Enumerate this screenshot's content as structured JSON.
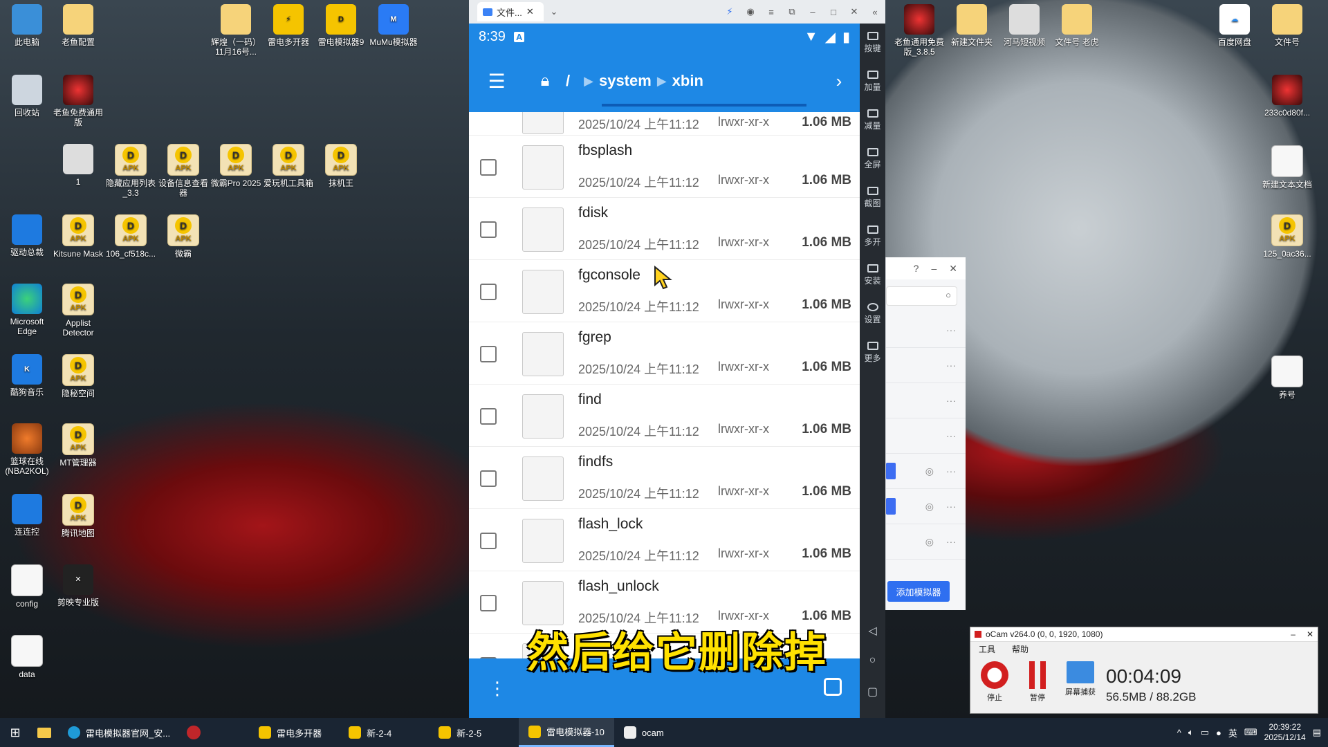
{
  "desktop_icons": [
    {
      "label": "此电脑",
      "icon": "computer-icon"
    },
    {
      "label": "老鱼配置",
      "icon": "folder-icon"
    },
    {
      "label": "回收站",
      "icon": "recycle-bin-icon"
    },
    {
      "label": "老鱼免费通用版",
      "icon": "app-icon"
    },
    {
      "label": "1",
      "icon": "photo-icon"
    },
    {
      "label": "隐藏应用列表_3.3",
      "icon": "apk-icon"
    },
    {
      "label": "设备信息查看器",
      "icon": "apk-icon"
    },
    {
      "label": "微霸Pro 2025",
      "icon": "apk-icon"
    },
    {
      "label": "爱玩机工具箱",
      "icon": "apk-icon"
    },
    {
      "label": "抹机王",
      "icon": "apk-icon"
    },
    {
      "label": "驱动总裁",
      "icon": "driver-icon"
    },
    {
      "label": "Kitsune Mask",
      "icon": "apk-icon"
    },
    {
      "label": "106_cf518c...",
      "icon": "apk-icon"
    },
    {
      "label": "微霸",
      "icon": "apk-icon"
    },
    {
      "label": "Microsoft Edge",
      "icon": "edge-icon"
    },
    {
      "label": "Applist Detector",
      "icon": "apk-icon"
    },
    {
      "label": "酷狗音乐",
      "icon": "kugou-icon"
    },
    {
      "label": "隐秘空间",
      "icon": "apk-icon"
    },
    {
      "label": "篮球在线(NBA2KOL)",
      "icon": "basketball-icon"
    },
    {
      "label": "MT管理器",
      "icon": "apk-icon"
    },
    {
      "label": "连连控",
      "icon": "remote-icon"
    },
    {
      "label": "腾讯地图",
      "icon": "apk-icon"
    },
    {
      "label": "config",
      "icon": "config-file-icon"
    },
    {
      "label": "剪映专业版",
      "icon": "capcut-icon"
    },
    {
      "label": "data",
      "icon": "data-file-icon"
    },
    {
      "label": "辉煌（一码）11月16号...",
      "icon": "folder-icon"
    },
    {
      "label": "雷电多开器",
      "icon": "multi-opener-icon"
    },
    {
      "label": "雷电模拟器9",
      "icon": "ldplayer-icon"
    },
    {
      "label": "MuMu模拟器",
      "icon": "mumu-icon"
    },
    {
      "label": "老鱼通用免费版_3.8.5",
      "icon": "app-icon"
    },
    {
      "label": "新建文件夹",
      "icon": "folder-icon"
    },
    {
      "label": "河马短视频",
      "icon": "hippo-icon"
    },
    {
      "label": "文件号 老虎",
      "icon": "folder-icon"
    },
    {
      "label": "百度网盘",
      "icon": "baidu-netdisk-icon"
    },
    {
      "label": "文件号",
      "icon": "folder-icon"
    },
    {
      "label": "233c0d80f...",
      "icon": "app-icon"
    },
    {
      "label": "新建文本文档",
      "icon": "text-file-icon"
    },
    {
      "label": "125_0ac36...",
      "icon": "apk-icon"
    },
    {
      "label": "养号",
      "icon": "text-file-icon"
    }
  ],
  "emulator": {
    "tab_label": "文件...",
    "sidebar": [
      {
        "label": "按键"
      },
      {
        "label": "加量"
      },
      {
        "label": "减量"
      },
      {
        "label": "全屏"
      },
      {
        "label": "截图"
      },
      {
        "label": "多开"
      },
      {
        "label": "安装"
      },
      {
        "label": "设置"
      },
      {
        "label": "更多"
      }
    ]
  },
  "phone": {
    "time": "8:39",
    "status_badge": "A",
    "path": {
      "root": "/",
      "segments": [
        "system",
        "xbin"
      ]
    },
    "partial_top_row": {
      "date": "2025/10/24 上午11:12",
      "perm": "lrwxr-xr-x",
      "size": "1.06 MB"
    },
    "files": [
      {
        "name": "fbsplash",
        "date": "2025/10/24 上午11:12",
        "perm": "lrwxr-xr-x",
        "size": "1.06 MB"
      },
      {
        "name": "fdisk",
        "date": "2025/10/24 上午11:12",
        "perm": "lrwxr-xr-x",
        "size": "1.06 MB"
      },
      {
        "name": "fgconsole",
        "date": "2025/10/24 上午11:12",
        "perm": "lrwxr-xr-x",
        "size": "1.06 MB"
      },
      {
        "name": "fgrep",
        "date": "2025/10/24 上午11:12",
        "perm": "lrwxr-xr-x",
        "size": "1.06 MB"
      },
      {
        "name": "find",
        "date": "2025/10/24 上午11:12",
        "perm": "lrwxr-xr-x",
        "size": "1.06 MB"
      },
      {
        "name": "findfs",
        "date": "2025/10/24 上午11:12",
        "perm": "lrwxr-xr-x",
        "size": "1.06 MB"
      },
      {
        "name": "flash_lock",
        "date": "2025/10/24 上午11:12",
        "perm": "lrwxr-xr-x",
        "size": "1.06 MB"
      },
      {
        "name": "flash_unlock",
        "date": "2025/10/24 上午11:12",
        "perm": "lrwxr-xr-x",
        "size": "1.06 MB"
      }
    ]
  },
  "caption": "然后给它删除掉",
  "manager": {
    "add_button": "添加模拟器"
  },
  "ocam": {
    "title": "oCam v264.0 (0, 0, 1920, 1080)",
    "menu": [
      "工具",
      "帮助"
    ],
    "buttons": [
      "停止",
      "暂停",
      "屏幕捕获"
    ],
    "elapsed": "00:04:09",
    "size": "56.5MB / 88.2GB"
  },
  "taskbar": {
    "apps": [
      {
        "label": "雷电模拟器官网_安...",
        "active": false
      },
      {
        "label": "雷电多开器",
        "active": false
      },
      {
        "label": "新-2-4",
        "active": false
      },
      {
        "label": "新-2-5",
        "active": false
      },
      {
        "label": "雷电模拟器-10",
        "active": true
      },
      {
        "label": "ocam",
        "active": false
      }
    ],
    "ime": "英",
    "time": "20:39:22",
    "date": "2025/12/14"
  },
  "colors": {
    "accent": "#1e88e5",
    "caption": "#ffe100"
  }
}
